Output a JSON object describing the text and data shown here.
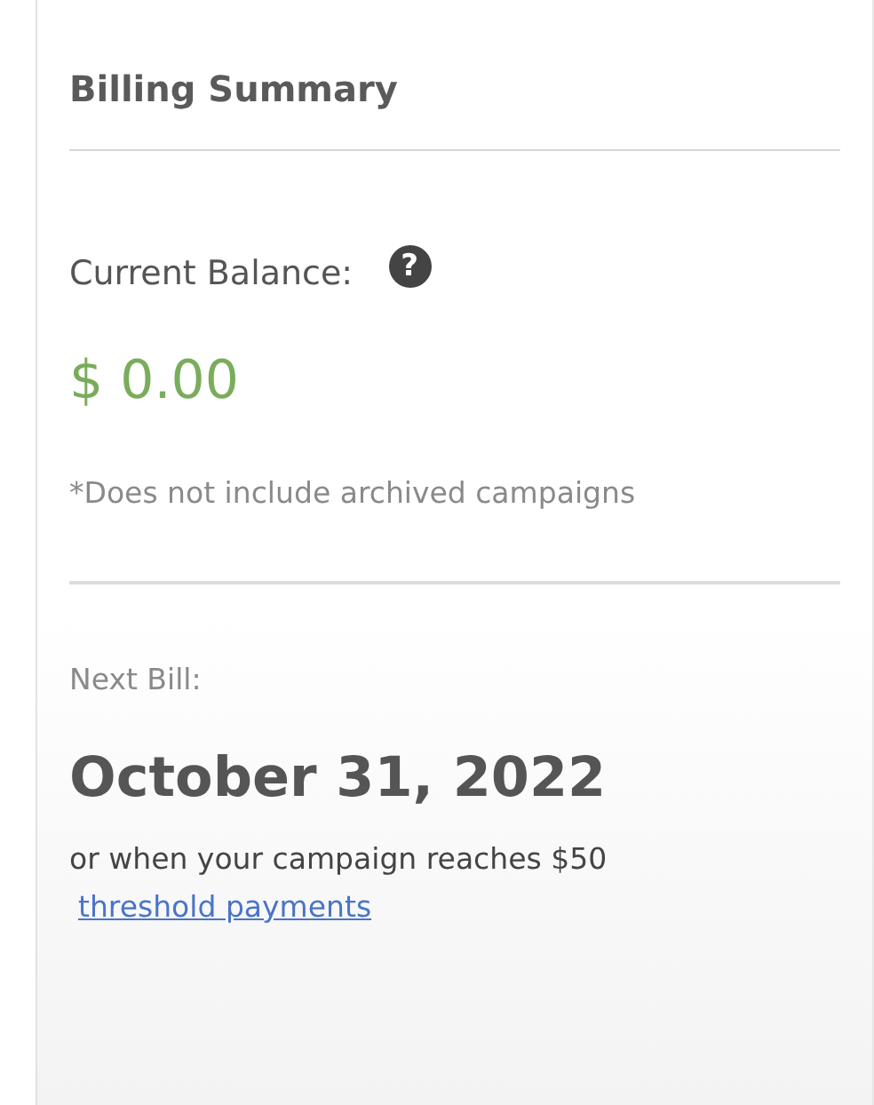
{
  "title": "Billing Summary",
  "balance": {
    "label": "Current Balance:",
    "help": "?",
    "amount": "$ 0.00",
    "note": "*Does not include archived campaigns"
  },
  "next_bill": {
    "label": "Next Bill:",
    "date": "October 31, 2022",
    "condition": "or when your campaign reaches $50",
    "link": "threshold payments"
  }
}
